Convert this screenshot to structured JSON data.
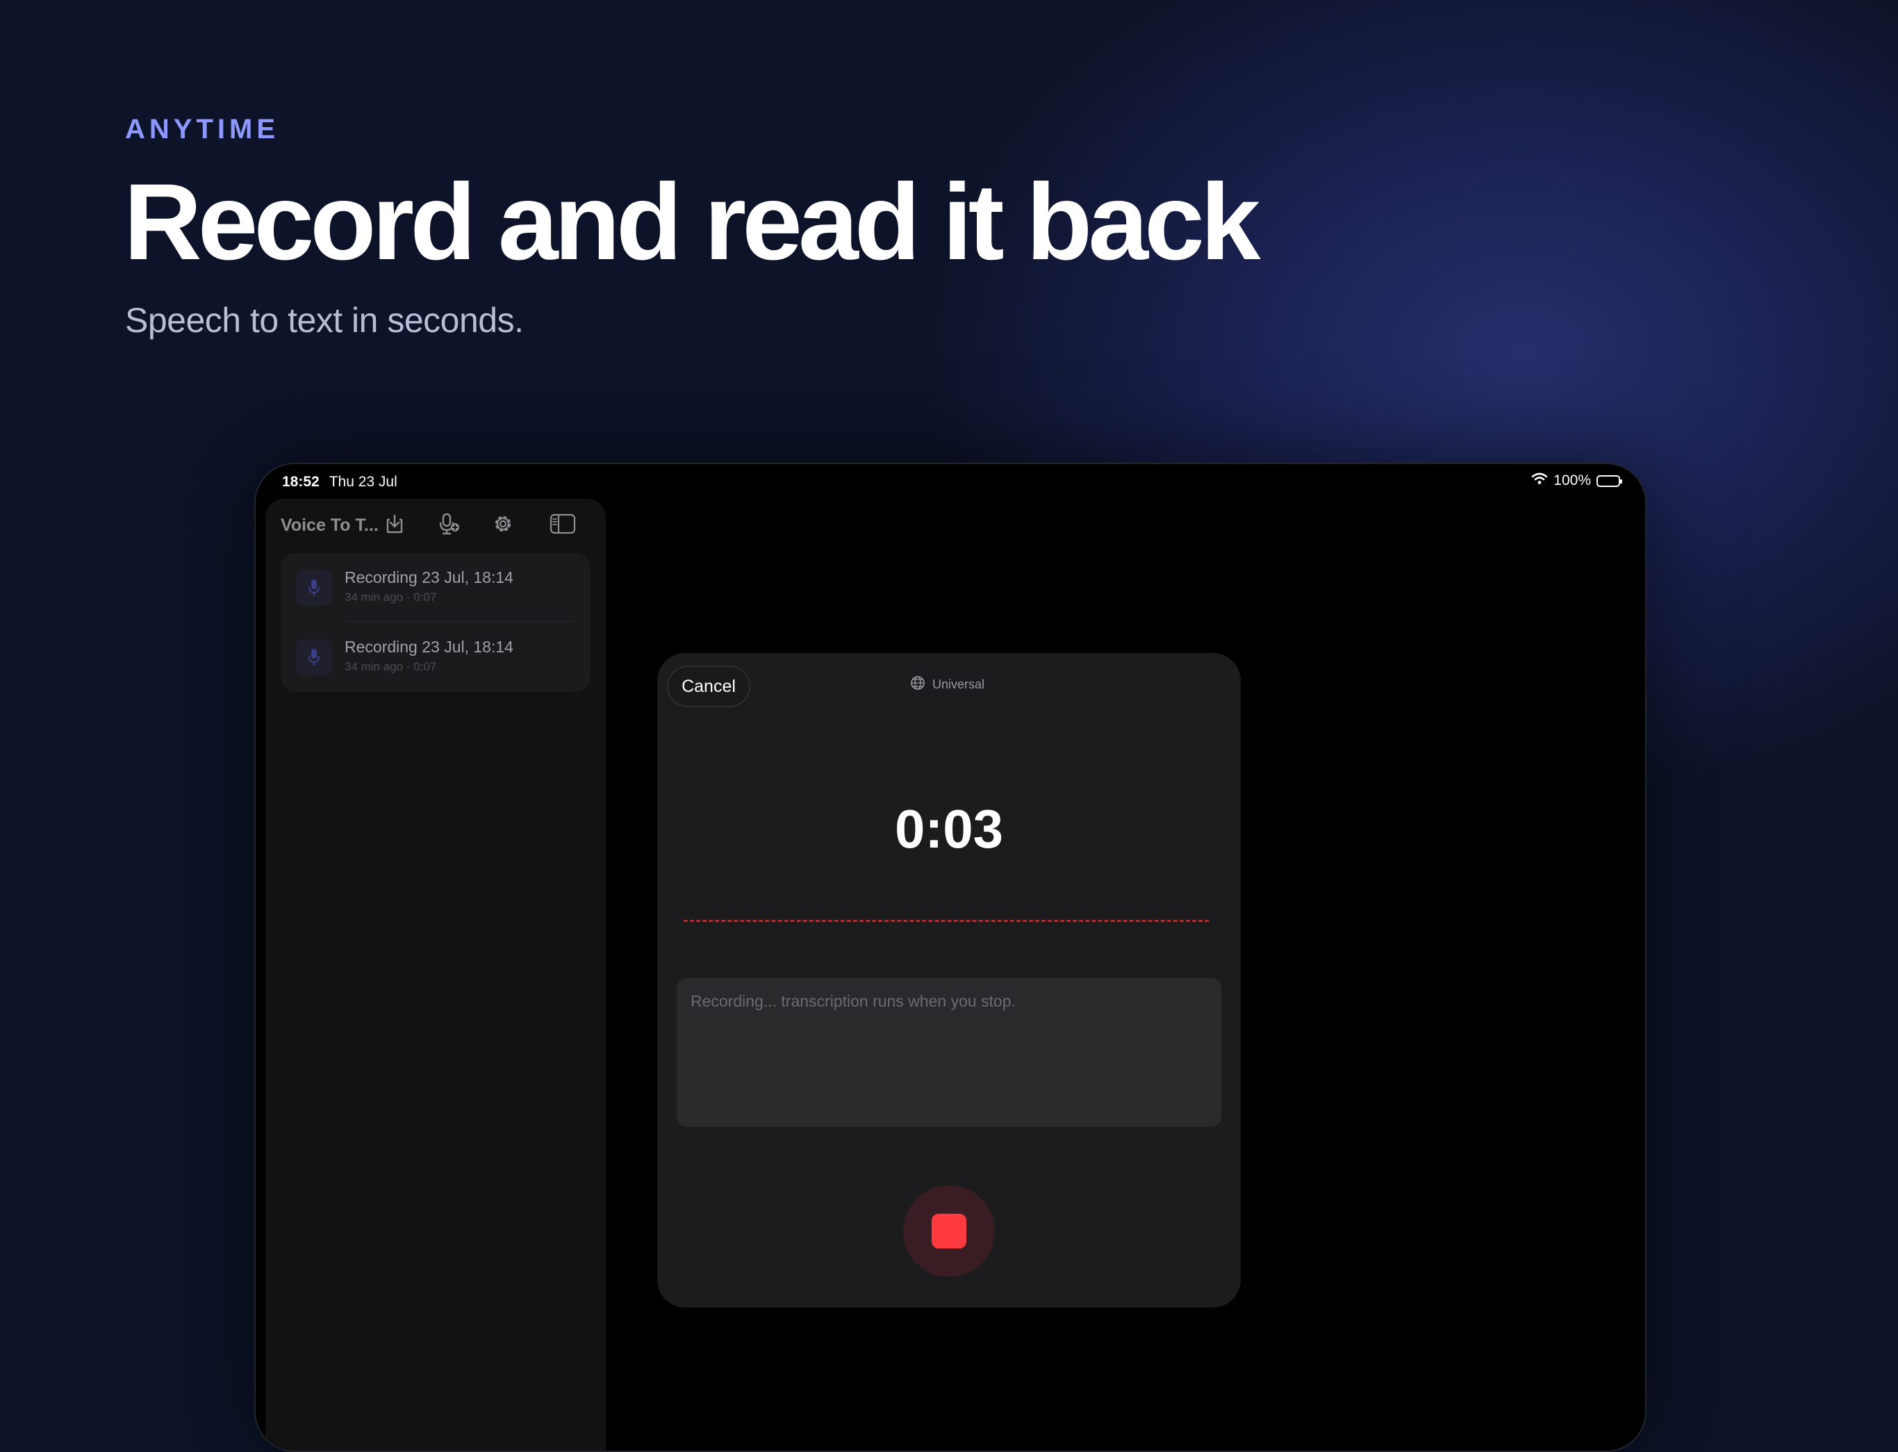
{
  "hero": {
    "eyebrow": "ANYTIME",
    "headline": "Record and read it back",
    "subline": "Speech to text in seconds."
  },
  "status_bar": {
    "time": "18:52",
    "date": "Thu 23 Jul",
    "battery": "100%",
    "battery_level": 1.0
  },
  "sidebar": {
    "title": "Voice To T...",
    "toolbar_icons": [
      "download-icon",
      "mic-plus-icon",
      "gear-icon",
      "sidebar-toggle-icon"
    ],
    "items": [
      {
        "title": "Recording 23 Jul, 18:14",
        "age": "34 min ago",
        "sep": "·",
        "duration": "0:07"
      },
      {
        "title": "Recording 23 Jul, 18:14",
        "age": "34 min ago",
        "sep": "·",
        "duration": "0:07"
      }
    ]
  },
  "recorder": {
    "cancel_label": "Cancel",
    "language": "Universal",
    "timer": "0:03",
    "transcript_placeholder": "Recording... transcription runs when you stop.",
    "accent_color": "#ff3b40"
  }
}
